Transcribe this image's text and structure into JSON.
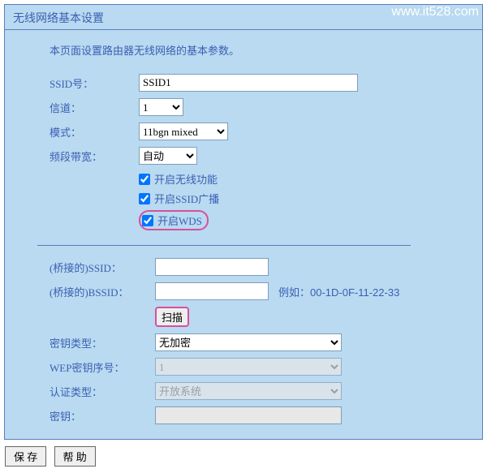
{
  "watermark": "www.it528.com",
  "panel": {
    "title": "无线网络基本设置",
    "description": "本页面设置路由器无线网络的基本参数。"
  },
  "basic": {
    "ssid_label": "SSID号：",
    "ssid_value": "SSID1",
    "channel_label": "信道：",
    "channel_value": "1",
    "mode_label": "模式：",
    "mode_value": "11bgn mixed",
    "band_label": "频段带宽：",
    "band_value": "自动"
  },
  "checks": {
    "enable_wireless": "开启无线功能",
    "enable_ssid_broadcast": "开启SSID广播",
    "enable_wds": "开启WDS"
  },
  "wds": {
    "bridge_ssid_label": "(桥接的)SSID：",
    "bridge_ssid_value": "",
    "bridge_bssid_label": "(桥接的)BSSID：",
    "bridge_bssid_value": "",
    "example_text": "例如：00-1D-0F-11-22-33",
    "scan_label": "扫描",
    "key_type_label": "密钥类型：",
    "key_type_value": "无加密",
    "wep_index_label": "WEP密钥序号：",
    "wep_index_value": "1",
    "auth_type_label": "认证类型：",
    "auth_type_value": "开放系统",
    "key_label": "密钥：",
    "key_value": ""
  },
  "buttons": {
    "save": "保 存",
    "help": "帮 助"
  }
}
